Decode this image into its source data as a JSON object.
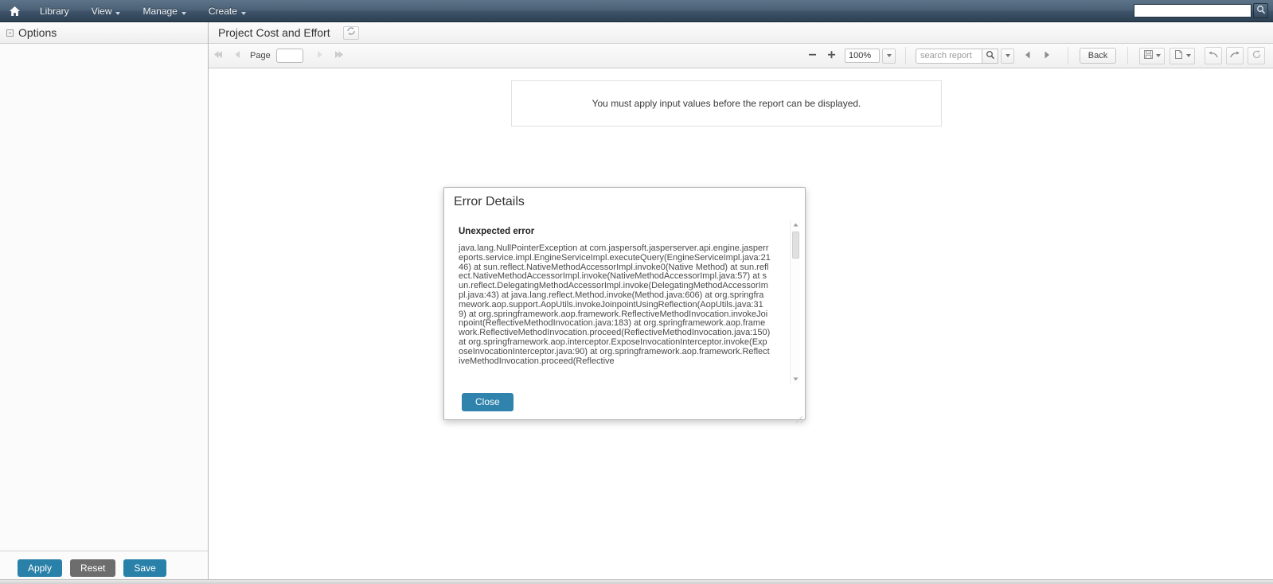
{
  "appbar": {
    "home_icon": "home-icon",
    "menus": [
      {
        "label": "Library",
        "has_caret": false
      },
      {
        "label": "View",
        "has_caret": true
      },
      {
        "label": "Manage",
        "has_caret": true
      },
      {
        "label": "Create",
        "has_caret": true
      }
    ],
    "search": {
      "value": "",
      "placeholder": "",
      "icon": "search-icon"
    }
  },
  "options_panel": {
    "title": "Options",
    "buttons": {
      "apply": "Apply",
      "reset": "Reset",
      "save": "Save"
    }
  },
  "report": {
    "title": "Project Cost and Effort",
    "refresh_icon": "refresh-icon",
    "toolbar": {
      "first_page_icon": "first-page-icon",
      "prev_page_icon": "previous-page-icon",
      "page_label": "Page",
      "page_value": "",
      "next_page_icon": "next-page-icon",
      "last_page_icon": "last-page-icon",
      "zoom_out_icon": "zoom-out-icon",
      "zoom_in_icon": "zoom-in-icon",
      "zoom_value": "100%",
      "zoom_dropdown_icon": "chevron-down-icon",
      "search_value": "",
      "search_placeholder": "search report",
      "search_icon": "search-icon",
      "search_dropdown_icon": "chevron-down-icon",
      "search_prev_icon": "search-previous-icon",
      "search_next_icon": "search-next-icon",
      "back_label": "Back",
      "save_icon": "floppy-disk-icon",
      "export_icon": "export-page-icon",
      "undo_icon": "undo-icon",
      "redo_icon": "redo-icon",
      "reset_icon": "reset-icon"
    },
    "notice": "You must apply input values before the report can be displayed."
  },
  "error_dialog": {
    "title": "Error Details",
    "heading": "Unexpected error",
    "stacktrace": "java.lang.NullPointerException at com.jaspersoft.jasperserver.api.engine.jasperreports.service.impl.EngineServiceImpl.executeQuery(EngineServiceImpl.java:2146) at sun.reflect.NativeMethodAccessorImpl.invoke0(Native Method) at sun.reflect.NativeMethodAccessorImpl.invoke(NativeMethodAccessorImpl.java:57) at sun.reflect.DelegatingMethodAccessorImpl.invoke(DelegatingMethodAccessorImpl.java:43) at java.lang.reflect.Method.invoke(Method.java:606) at org.springframework.aop.support.AopUtils.invokeJoinpointUsingReflection(AopUtils.java:319) at org.springframework.aop.framework.ReflectiveMethodInvocation.invokeJoinpoint(ReflectiveMethodInvocation.java:183) at org.springframework.aop.framework.ReflectiveMethodInvocation.proceed(ReflectiveMethodInvocation.java:150) at org.springframework.aop.interceptor.ExposeInvocationInterceptor.invoke(ExposeInvocationInterceptor.java:90) at org.springframework.aop.framework.ReflectiveMethodInvocation.proceed(Reflective",
    "close_label": "Close",
    "scroll_up_icon": "scroll-up-arrow-icon",
    "scroll_down_icon": "scroll-down-arrow-icon",
    "resize_grip_icon": "resize-grip-icon"
  },
  "colors": {
    "appbar_top": "#5d7389",
    "appbar_bottom": "#2e4154",
    "primary_button": "#2980a8",
    "secondary_button": "#6d6d6d",
    "dialog_button": "#2f83ad"
  }
}
